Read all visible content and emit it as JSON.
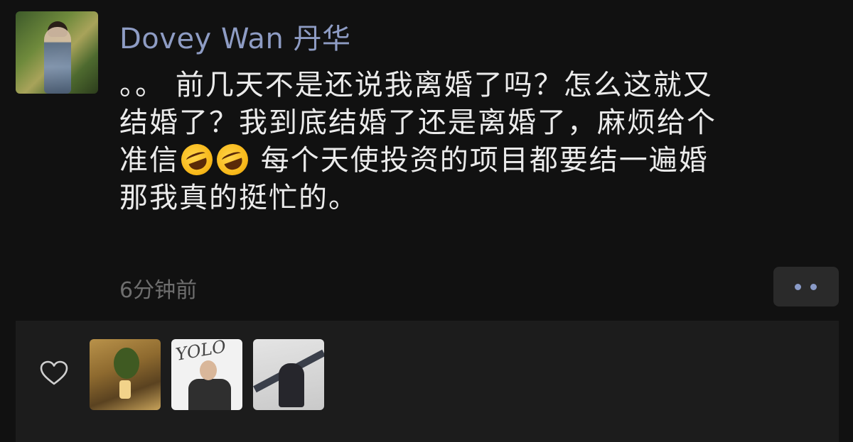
{
  "post": {
    "author_name": "Dovey Wan 丹华",
    "message_lines": [
      {
        "text": "。。 前几天不是还说我离婚了吗？怎么这就又"
      },
      {
        "text": "结婚了？我到底结婚了还是离婚了，麻烦给个"
      },
      {
        "before": "准信",
        "emoji_count": 2,
        "emoji": "rolling-on-the-floor-laughing-emoji",
        "after": " 每个天使投资的项目都要结一遍婚"
      },
      {
        "text": "那我真的挺忙的。"
      }
    ],
    "timestamp": "6分钟前"
  },
  "actions": {
    "more_icon": "ellipsis-icon"
  },
  "likes": {
    "heart_icon": "heart-outline-icon",
    "liker_avatar_2_text": "YOLO"
  },
  "colors": {
    "background": "#111111",
    "author_name": "#8e9cc4",
    "message_text": "#ebebeb",
    "timestamp": "#6e6e6e",
    "likes_panel": "#1c1c1c"
  }
}
